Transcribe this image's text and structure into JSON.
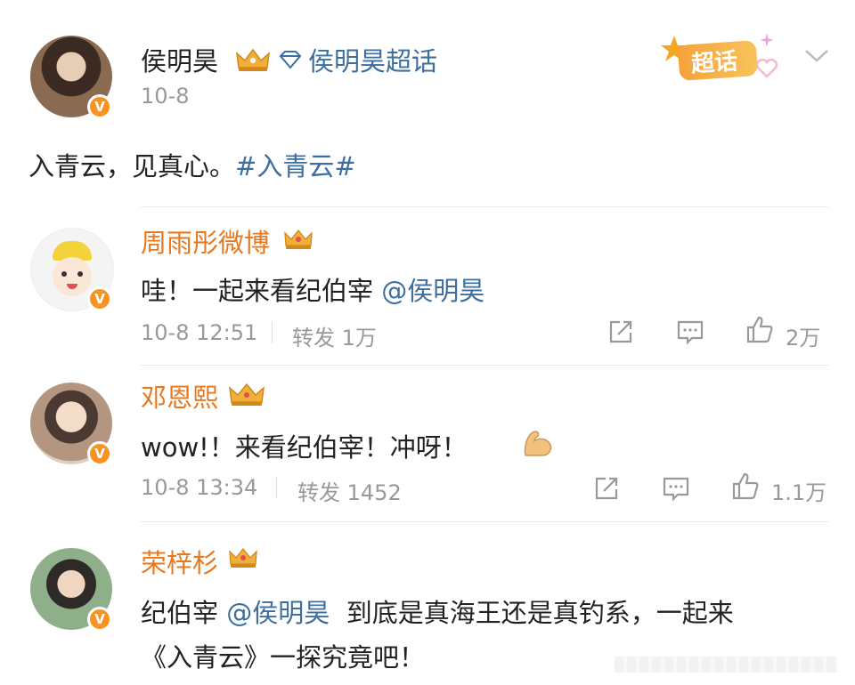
{
  "post": {
    "author": "侯明昊",
    "supertopic_label": "侯明昊超话",
    "date": "10-8",
    "badge_text": "超话",
    "content_text": "入青云，见真心。",
    "hashtag": "#入青云#"
  },
  "comments": [
    {
      "author": "周雨彤微博",
      "text": "哇！一起来看纪伯宰",
      "mention": "@侯明昊",
      "time": "10-8 12:51",
      "repost_label": "转发",
      "repost_count": "1万",
      "like_count": "2万"
    },
    {
      "author": "邓恩熙",
      "text": "wow!！来看纪伯宰！冲呀！",
      "time": "10-8 13:34",
      "repost_label": "转发",
      "repost_count": "1452",
      "like_count": "1.1万"
    },
    {
      "author": "荣梓杉",
      "text_prefix": "纪伯宰",
      "mention": "@侯明昊",
      "text_suffix": "到底是真海王还是真钓系，一起来",
      "text_line2": "《入青云》一探究竟吧！"
    }
  ],
  "colors": {
    "accent_orange": "#e8781e",
    "link_blue": "#3d6e9e",
    "meta_gray": "#999999",
    "verified_badge": "#f7931e"
  }
}
